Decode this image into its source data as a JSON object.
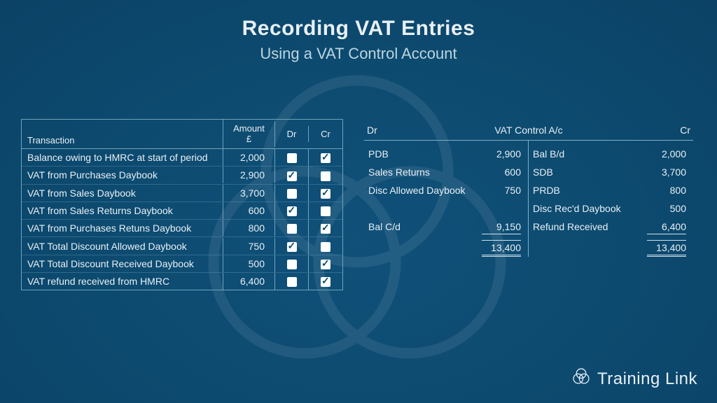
{
  "title": "Recording VAT Entries",
  "subtitle": "Using a VAT Control Account",
  "brand": "Training Link",
  "table": {
    "headers": {
      "transaction": "Transaction",
      "amount_line1": "Amount",
      "amount_line2": "£",
      "dr": "Dr",
      "cr": "Cr"
    },
    "rows": [
      {
        "label": "Balance owing to HMRC at start of period",
        "amount": "2,000",
        "dr": false,
        "cr": true
      },
      {
        "label": "VAT from Purchases Daybook",
        "amount": "2,900",
        "dr": true,
        "cr": false
      },
      {
        "label": "VAT from Sales Daybook",
        "amount": "3,700",
        "dr": false,
        "cr": true
      },
      {
        "label": "VAT from Sales Returns Daybook",
        "amount": "600",
        "dr": true,
        "cr": false
      },
      {
        "label": "VAT from Purchases Retuns Daybook",
        "amount": "800",
        "dr": false,
        "cr": true
      },
      {
        "label": "VAT Total Discount Allowed Daybook",
        "amount": "750",
        "dr": true,
        "cr": false
      },
      {
        "label": "VAT Total Discount Received Daybook",
        "amount": "500",
        "dr": false,
        "cr": true
      },
      {
        "label": "VAT refund received from HMRC",
        "amount": "6,400",
        "dr": false,
        "cr": true
      }
    ]
  },
  "t_account": {
    "title": "VAT Control A/c",
    "dr_label": "Dr",
    "cr_label": "Cr",
    "debit": [
      {
        "label": "PDB",
        "value": "2,900"
      },
      {
        "label": "Sales Returns",
        "value": "600"
      },
      {
        "label": "Disc Allowed Daybook",
        "value": "750"
      }
    ],
    "debit_balance": {
      "label": "Bal C/d",
      "value": "9,150"
    },
    "debit_total": "13,400",
    "credit": [
      {
        "label": "Bal B/d",
        "value": "2,000"
      },
      {
        "label": "SDB",
        "value": "3,700"
      },
      {
        "label": "PRDB",
        "value": "800"
      },
      {
        "label": "Disc Rec'd Daybook",
        "value": "500"
      },
      {
        "label": "Refund Received",
        "value": "6,400"
      }
    ],
    "credit_total": "13,400"
  }
}
